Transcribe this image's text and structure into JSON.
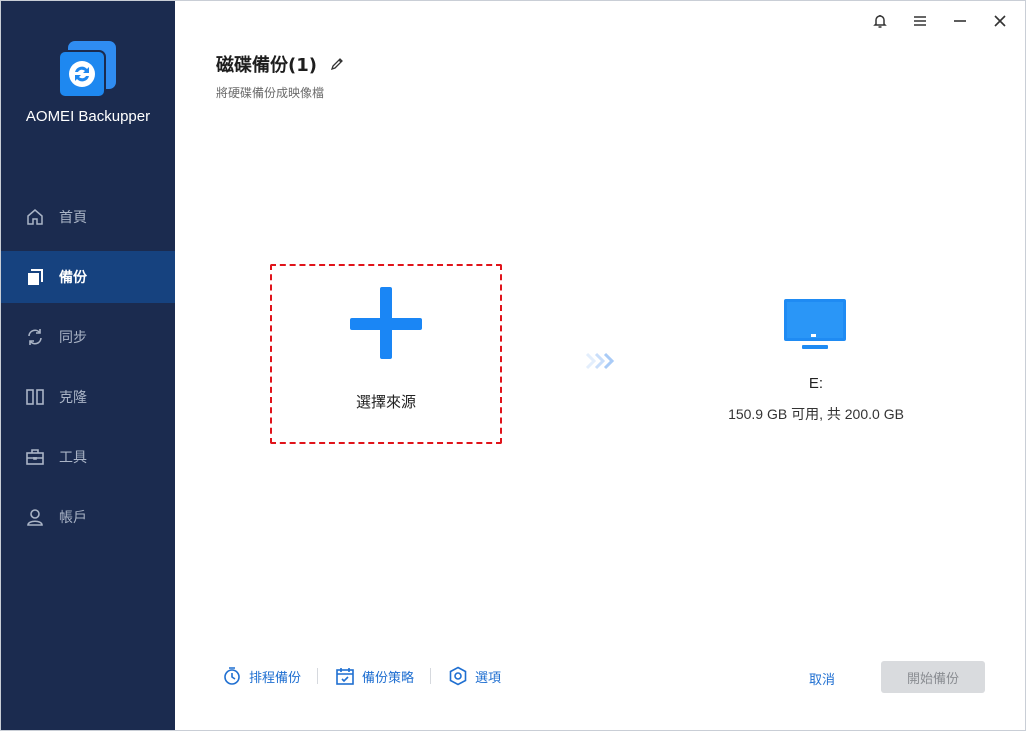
{
  "app": {
    "name": "AOMEI Backupper",
    "brand_color": "#1e88f0",
    "sidebar_bg": "#1b2b4f",
    "active_bg": "#16427f"
  },
  "sidebar": {
    "items": [
      {
        "label": "首頁",
        "icon": "home-icon",
        "active": false
      },
      {
        "label": "備份",
        "icon": "backup-icon",
        "active": true
      },
      {
        "label": "同步",
        "icon": "sync-icon",
        "active": false
      },
      {
        "label": "克隆",
        "icon": "clone-icon",
        "active": false
      },
      {
        "label": "工具",
        "icon": "toolbox-icon",
        "active": false
      },
      {
        "label": "帳戶",
        "icon": "user-icon",
        "active": false
      }
    ]
  },
  "window_controls": [
    "bell-icon",
    "menu-icon",
    "minimize-icon",
    "close-icon"
  ],
  "header": {
    "title": "磁碟備份(1)",
    "subtitle": "將硬碟備份成映像檔"
  },
  "source": {
    "label": "選擇來源",
    "highlight_color": "#e0141b"
  },
  "destination": {
    "name": "E:",
    "size": "150.9 GB 可用, 共 200.0 GB"
  },
  "bottom": {
    "schedule": "排程備份",
    "scheme": "備份策略",
    "options": "選項",
    "cancel": "取消",
    "start": "開始備份"
  }
}
